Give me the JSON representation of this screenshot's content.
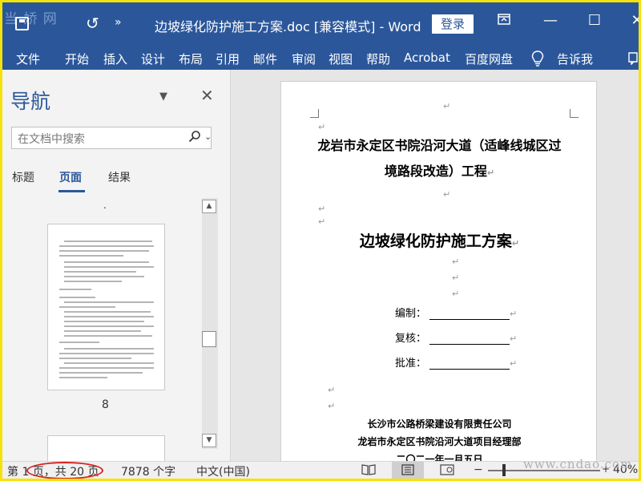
{
  "titlebar": {
    "watermark": "当 娇 网",
    "undo_glyph": "↺",
    "more_glyph": "»",
    "document_title": "边坡绿化防护施工方案.doc [兼容模式] - Word",
    "login_label": "登录",
    "ribbon_display_icon": "ribbon-display-options-icon",
    "min_glyph": "—",
    "max_glyph": "☐",
    "close_glyph": "✕"
  },
  "ribbon": {
    "tabs": [
      "文件",
      "开始",
      "插入",
      "设计",
      "布局",
      "引用",
      "邮件",
      "审阅",
      "视图",
      "帮助",
      "Acrobat",
      "百度网盘",
      "告诉我"
    ],
    "tell_me_icon": "lightbulb-icon"
  },
  "nav": {
    "title": "导航",
    "dropdown_glyph": "▼",
    "close_glyph": "✕",
    "search_placeholder": "在文档中搜索",
    "search_icon_glyph": "⚲",
    "search_dd_glyph": "⌄",
    "tabs": [
      "标题",
      "页面",
      "结果"
    ],
    "active_tab": "页面",
    "page_number": "8",
    "dot": "."
  },
  "document": {
    "para_mark": "↵",
    "project_line1": "龙岩市永定区书院沿河大道（适峰线城区过",
    "project_line2": "境路段改造）工程",
    "main_title": "边坡绿化防护施工方案",
    "field_compile": "编制：",
    "field_review": "复核：",
    "field_approve": "批准：",
    "company1": "长沙市公路桥梁建设有限责任公司",
    "company2": "龙岩市永定区书院沿河大道项目经理部",
    "date": "二〇二一年一月五日"
  },
  "status": {
    "page_info": "第 1 页，共 20 页",
    "word_count": "7878 个字",
    "language": "中文(中国)",
    "zoom_minus": "−",
    "zoom_plus": "+",
    "zoom_level": "40%",
    "watermark": "www.cndao.com"
  },
  "colors": {
    "word_blue": "#2b579a",
    "highlight_border": "#f5e20a",
    "annotation_red": "#d92020"
  }
}
